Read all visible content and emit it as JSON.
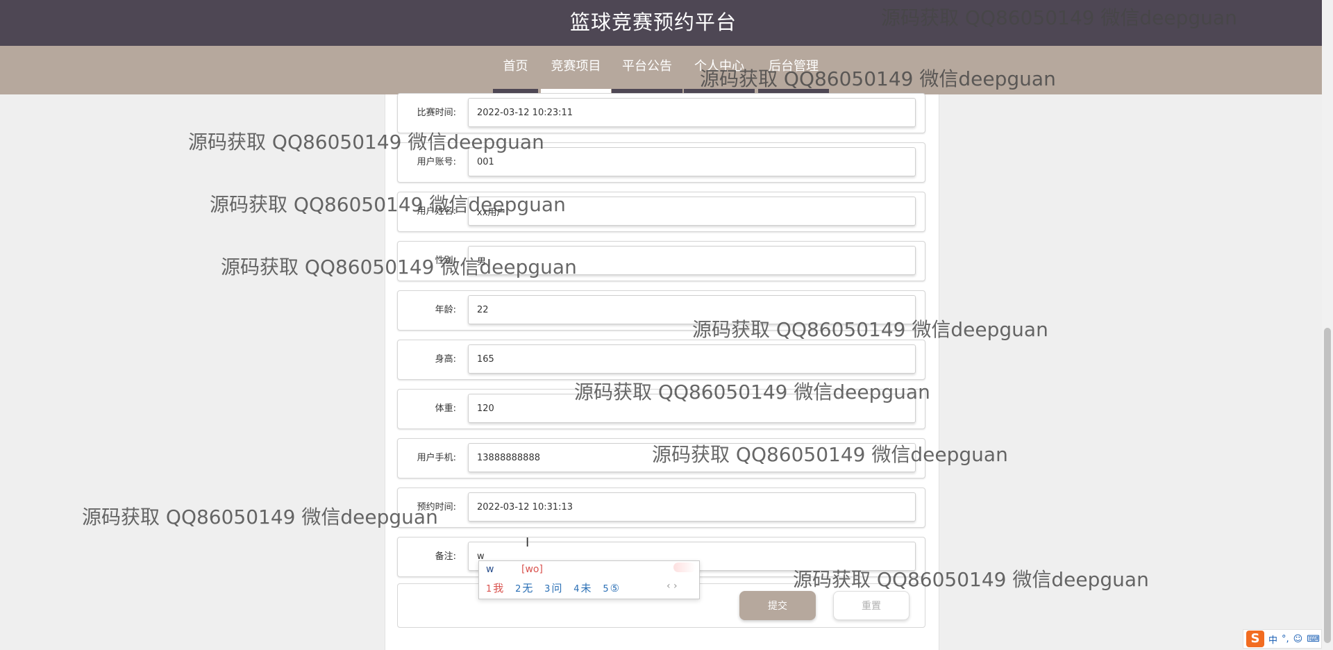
{
  "header": {
    "title": "篮球竞赛预约平台"
  },
  "nav": {
    "items": [
      "首页",
      "竞赛项目",
      "平台公告",
      "个人中心",
      "后台管理"
    ],
    "active_index": 1
  },
  "form": {
    "rows": [
      {
        "label": "比赛时间:",
        "value": "2022-03-12 10:23:11"
      },
      {
        "label": "用户账号:",
        "value": "001"
      },
      {
        "label": "用户姓名:",
        "value": "xx用户"
      },
      {
        "label": "性别:",
        "value": "男"
      },
      {
        "label": "年龄:",
        "value": "22"
      },
      {
        "label": "身高:",
        "value": "165"
      },
      {
        "label": "体重:",
        "value": "120"
      },
      {
        "label": "用户手机:",
        "value": "13888888888"
      },
      {
        "label": "预约时间:",
        "value": "2022-03-12 10:31:13"
      },
      {
        "label": "备注:",
        "value": "w"
      }
    ],
    "submit_label": "提交",
    "reset_label": "重置"
  },
  "ime": {
    "composition": "w",
    "pinyin": "[wo]",
    "candidates": [
      {
        "num": "1",
        "text": "我"
      },
      {
        "num": "2",
        "text": "无"
      },
      {
        "num": "3",
        "text": "问"
      },
      {
        "num": "4",
        "text": "未"
      },
      {
        "num": "5",
        "text": "⑤"
      }
    ],
    "arrows": "‹ ›"
  },
  "watermark": {
    "text": "源码获取 QQ86050149 微信deepguan"
  },
  "tray": {
    "lang": "中",
    "punct": "°,",
    "emoji": "☺",
    "keyboard": "⌨"
  },
  "colors": {
    "topbar": "#4e4754",
    "navbar": "#b6a89d",
    "submit": "#b6a89d"
  }
}
